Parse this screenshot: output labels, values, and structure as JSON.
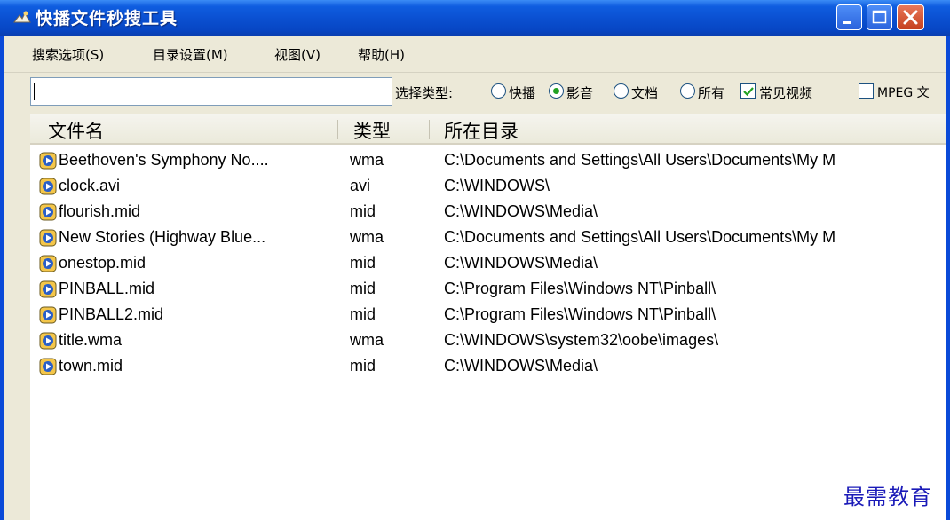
{
  "window": {
    "title": "快播文件秒搜工具",
    "colors": {
      "titlebar": "#0A4FD0",
      "close_button": "#C5401E",
      "selected_radio": "#21A121"
    }
  },
  "menu": {
    "items": [
      "搜索选项(S)",
      "目录设置(M)",
      "视图(V)",
      "帮助(H)"
    ]
  },
  "toolbar": {
    "search_value": "",
    "type_label": "选择类型:",
    "radios": [
      {
        "label": "快播",
        "selected": false
      },
      {
        "label": "影音",
        "selected": true
      },
      {
        "label": "文档",
        "selected": false
      },
      {
        "label": "所有",
        "selected": false
      }
    ],
    "checkboxes": [
      {
        "label": "常见视频",
        "checked": true
      },
      {
        "label": "MPEG 文",
        "checked": false
      }
    ]
  },
  "list": {
    "columns": [
      "文件名",
      "类型",
      "所在目录"
    ],
    "rows": [
      {
        "name": "Beethoven's Symphony No....",
        "type": "wma",
        "dir": "C:\\Documents and Settings\\All Users\\Documents\\My M"
      },
      {
        "name": "clock.avi",
        "type": "avi",
        "dir": "C:\\WINDOWS\\"
      },
      {
        "name": "flourish.mid",
        "type": "mid",
        "dir": "C:\\WINDOWS\\Media\\"
      },
      {
        "name": "New Stories (Highway Blue...",
        "type": "wma",
        "dir": "C:\\Documents and Settings\\All Users\\Documents\\My M"
      },
      {
        "name": "onestop.mid",
        "type": "mid",
        "dir": "C:\\WINDOWS\\Media\\"
      },
      {
        "name": "PINBALL.mid",
        "type": "mid",
        "dir": "C:\\Program Files\\Windows NT\\Pinball\\"
      },
      {
        "name": "PINBALL2.mid",
        "type": "mid",
        "dir": "C:\\Program Files\\Windows NT\\Pinball\\"
      },
      {
        "name": "title.wma",
        "type": "wma",
        "dir": "C:\\WINDOWS\\system32\\oobe\\images\\"
      },
      {
        "name": "town.mid",
        "type": "mid",
        "dir": "C:\\WINDOWS\\Media\\"
      }
    ]
  },
  "watermark": "最需教育"
}
